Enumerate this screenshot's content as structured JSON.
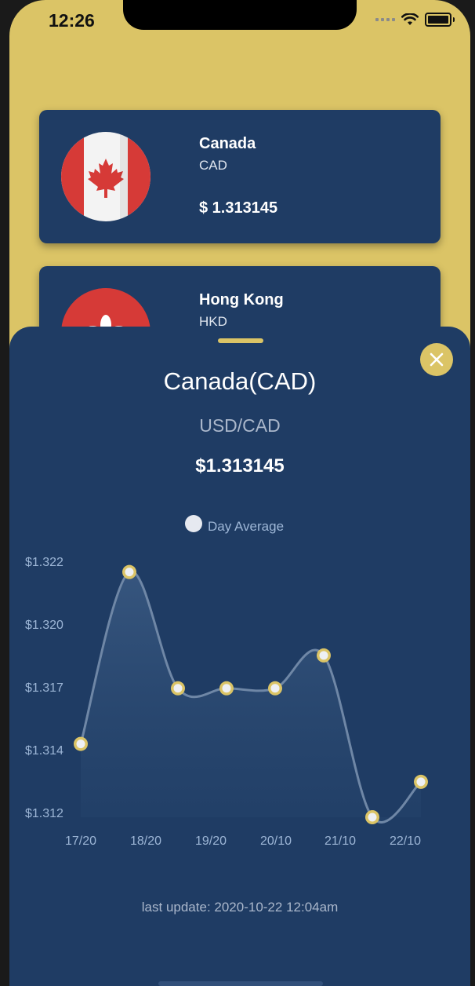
{
  "status_bar": {
    "time": "12:26"
  },
  "cards": [
    {
      "name": "Canada",
      "code": "CAD",
      "rate": "$ 1.313145"
    },
    {
      "name": "Hong Kong",
      "code": "HKD"
    }
  ],
  "detail": {
    "title": "Canada(CAD)",
    "pair": "USD/CAD",
    "rate": "$1.313145",
    "last_update": "last update: 2020-10-22 12:04am"
  },
  "colors": {
    "background": "#dbc466",
    "card": "#1f3c64",
    "accent": "#dbc466"
  },
  "chart_data": {
    "type": "line",
    "series": [
      {
        "name": "Day Average",
        "values": [
          1.3148,
          1.3216,
          1.317,
          1.317,
          1.317,
          1.3183,
          1.3119,
          1.3133
        ]
      }
    ],
    "x_ticks": [
      "17/20",
      "18/20",
      "19/20",
      "20/10",
      "21/10",
      "22/10"
    ],
    "y_ticks": [
      "$1.322",
      "$1.320",
      "$1.317",
      "$1.314",
      "$1.312"
    ],
    "ylim": [
      1.3119,
      1.3219
    ],
    "legend_placement": "top-center",
    "grid": false
  }
}
